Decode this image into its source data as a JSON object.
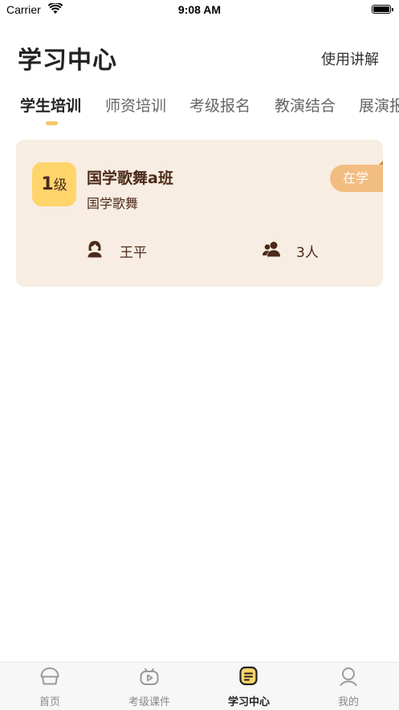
{
  "status_bar": {
    "carrier": "Carrier",
    "time": "9:08 AM"
  },
  "header": {
    "title": "学习中心",
    "guide_link": "使用讲解"
  },
  "tabs": [
    {
      "label": "学生培训",
      "active": true
    },
    {
      "label": "师资培训",
      "active": false
    },
    {
      "label": "考级报名",
      "active": false
    },
    {
      "label": "教演结合",
      "active": false
    },
    {
      "label": "展演报",
      "active": false
    }
  ],
  "class_card": {
    "level_number": "1",
    "level_unit": "级",
    "name": "国学歌舞a班",
    "category": "国学歌舞",
    "status": "在学",
    "teacher": "王平",
    "student_count": "3人",
    "icons": {
      "teacher": "female-teacher-icon",
      "students": "people-icon"
    }
  },
  "bottom_nav": [
    {
      "label": "首页",
      "icon": "home-icon",
      "active": false
    },
    {
      "label": "考级课件",
      "icon": "video-play-icon",
      "active": false
    },
    {
      "label": "学习中心",
      "icon": "study-center-icon",
      "active": true
    },
    {
      "label": "我的",
      "icon": "user-icon",
      "active": false
    }
  ],
  "colors": {
    "accent": "#fed46b",
    "card_background": "#f8ede2",
    "status_badge": "#f2bd81",
    "text_brown": "#4b2a1a"
  }
}
